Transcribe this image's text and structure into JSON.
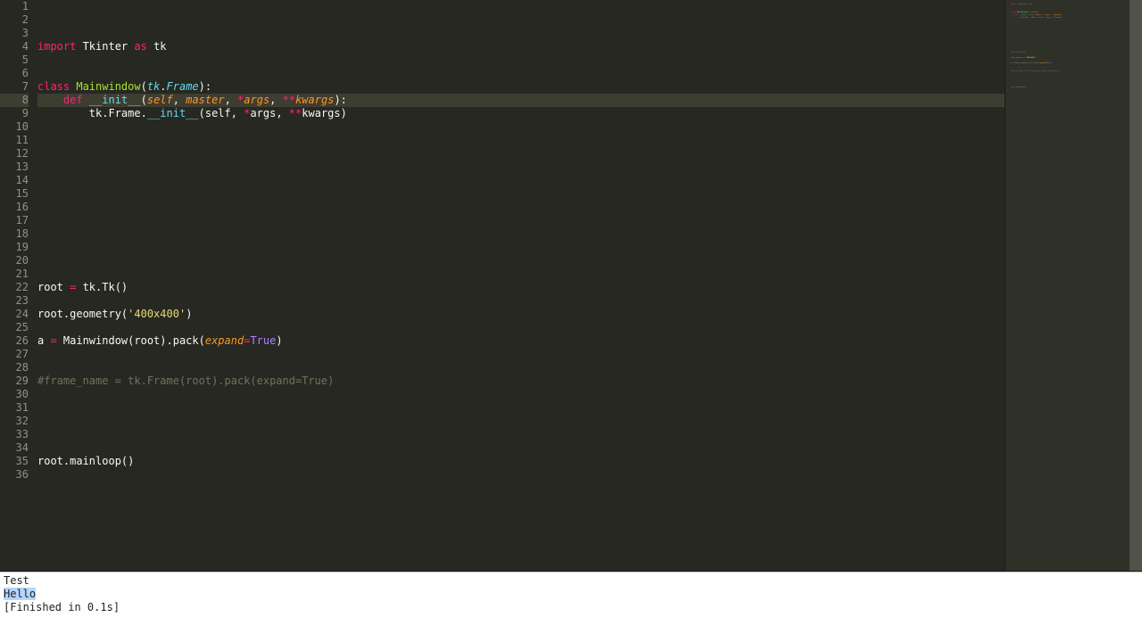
{
  "editor": {
    "highlighted_line": 8,
    "total_lines": 36,
    "code_lines": {
      "1": [
        [
          "kw",
          "import"
        ],
        [
          "",
          " Tkinter "
        ],
        [
          "kw",
          "as"
        ],
        [
          "",
          " tk"
        ]
      ],
      "2": [],
      "3": [],
      "4": [
        [
          "kw",
          "class"
        ],
        [
          "",
          " "
        ],
        [
          "name",
          "Mainwindow"
        ],
        [
          "",
          "("
        ],
        [
          "kw2",
          "tk"
        ],
        [
          "",
          "."
        ],
        [
          "kw2",
          "Frame"
        ],
        [
          "",
          "):"
        ]
      ],
      "5": [
        [
          "",
          "    "
        ],
        [
          "kw",
          "def"
        ],
        [
          "",
          " "
        ],
        [
          "fn",
          "__init__"
        ],
        [
          "",
          "("
        ],
        [
          "self",
          "self"
        ],
        [
          "",
          ", "
        ],
        [
          "arg",
          "master"
        ],
        [
          "",
          ", "
        ],
        [
          "op",
          "*"
        ],
        [
          "arg",
          "args"
        ],
        [
          "",
          ", "
        ],
        [
          "op",
          "**"
        ],
        [
          "arg",
          "kwargs"
        ],
        [
          "",
          "):"
        ]
      ],
      "6": [
        [
          "",
          "        tk.Frame."
        ],
        [
          "fn",
          "__init__"
        ],
        [
          "",
          "(self, "
        ],
        [
          "op",
          "*"
        ],
        [
          "",
          "args, "
        ],
        [
          "op",
          "**"
        ],
        [
          "",
          "kwargs)"
        ]
      ],
      "7": [],
      "8": [
        [
          "",
          "        "
        ]
      ],
      "9": [],
      "10": [],
      "11": [],
      "12": [],
      "13": [],
      "14": [],
      "15": [],
      "16": [],
      "17": [],
      "18": [],
      "19": [
        [
          "",
          "root "
        ],
        [
          "op",
          "="
        ],
        [
          "",
          " tk.Tk()"
        ]
      ],
      "20": [],
      "21": [
        [
          "",
          "root.geometry("
        ],
        [
          "str",
          "'400x400'"
        ],
        [
          "",
          ")"
        ]
      ],
      "22": [],
      "23": [
        [
          "",
          "a "
        ],
        [
          "op",
          "="
        ],
        [
          "",
          " Mainwindow(root).pack("
        ],
        [
          "arg",
          "expand"
        ],
        [
          "op",
          "="
        ],
        [
          "bool",
          "True"
        ],
        [
          "",
          ")"
        ]
      ],
      "24": [],
      "25": [],
      "26": [
        [
          "cmt",
          "#frame_name = tk.Frame(root).pack(expand=True)"
        ]
      ],
      "27": [],
      "28": [],
      "29": [],
      "30": [],
      "31": [],
      "32": [
        [
          "",
          "root.mainloop()"
        ]
      ],
      "33": [],
      "34": [],
      "35": [],
      "36": []
    }
  },
  "console": {
    "lines": [
      "Test",
      "Hello",
      "[Finished in 0.1s]"
    ],
    "selected_line_index": 1
  },
  "minimap": {
    "colors": {
      "kw": "#f92672",
      "name": "#a6e22e",
      "arg": "#fd971f",
      "str": "#e6db74",
      "cmt": "#75715e",
      "def": "#8f8f83",
      "fn": "#66d9ef",
      "bool": "#ae81ff"
    }
  }
}
